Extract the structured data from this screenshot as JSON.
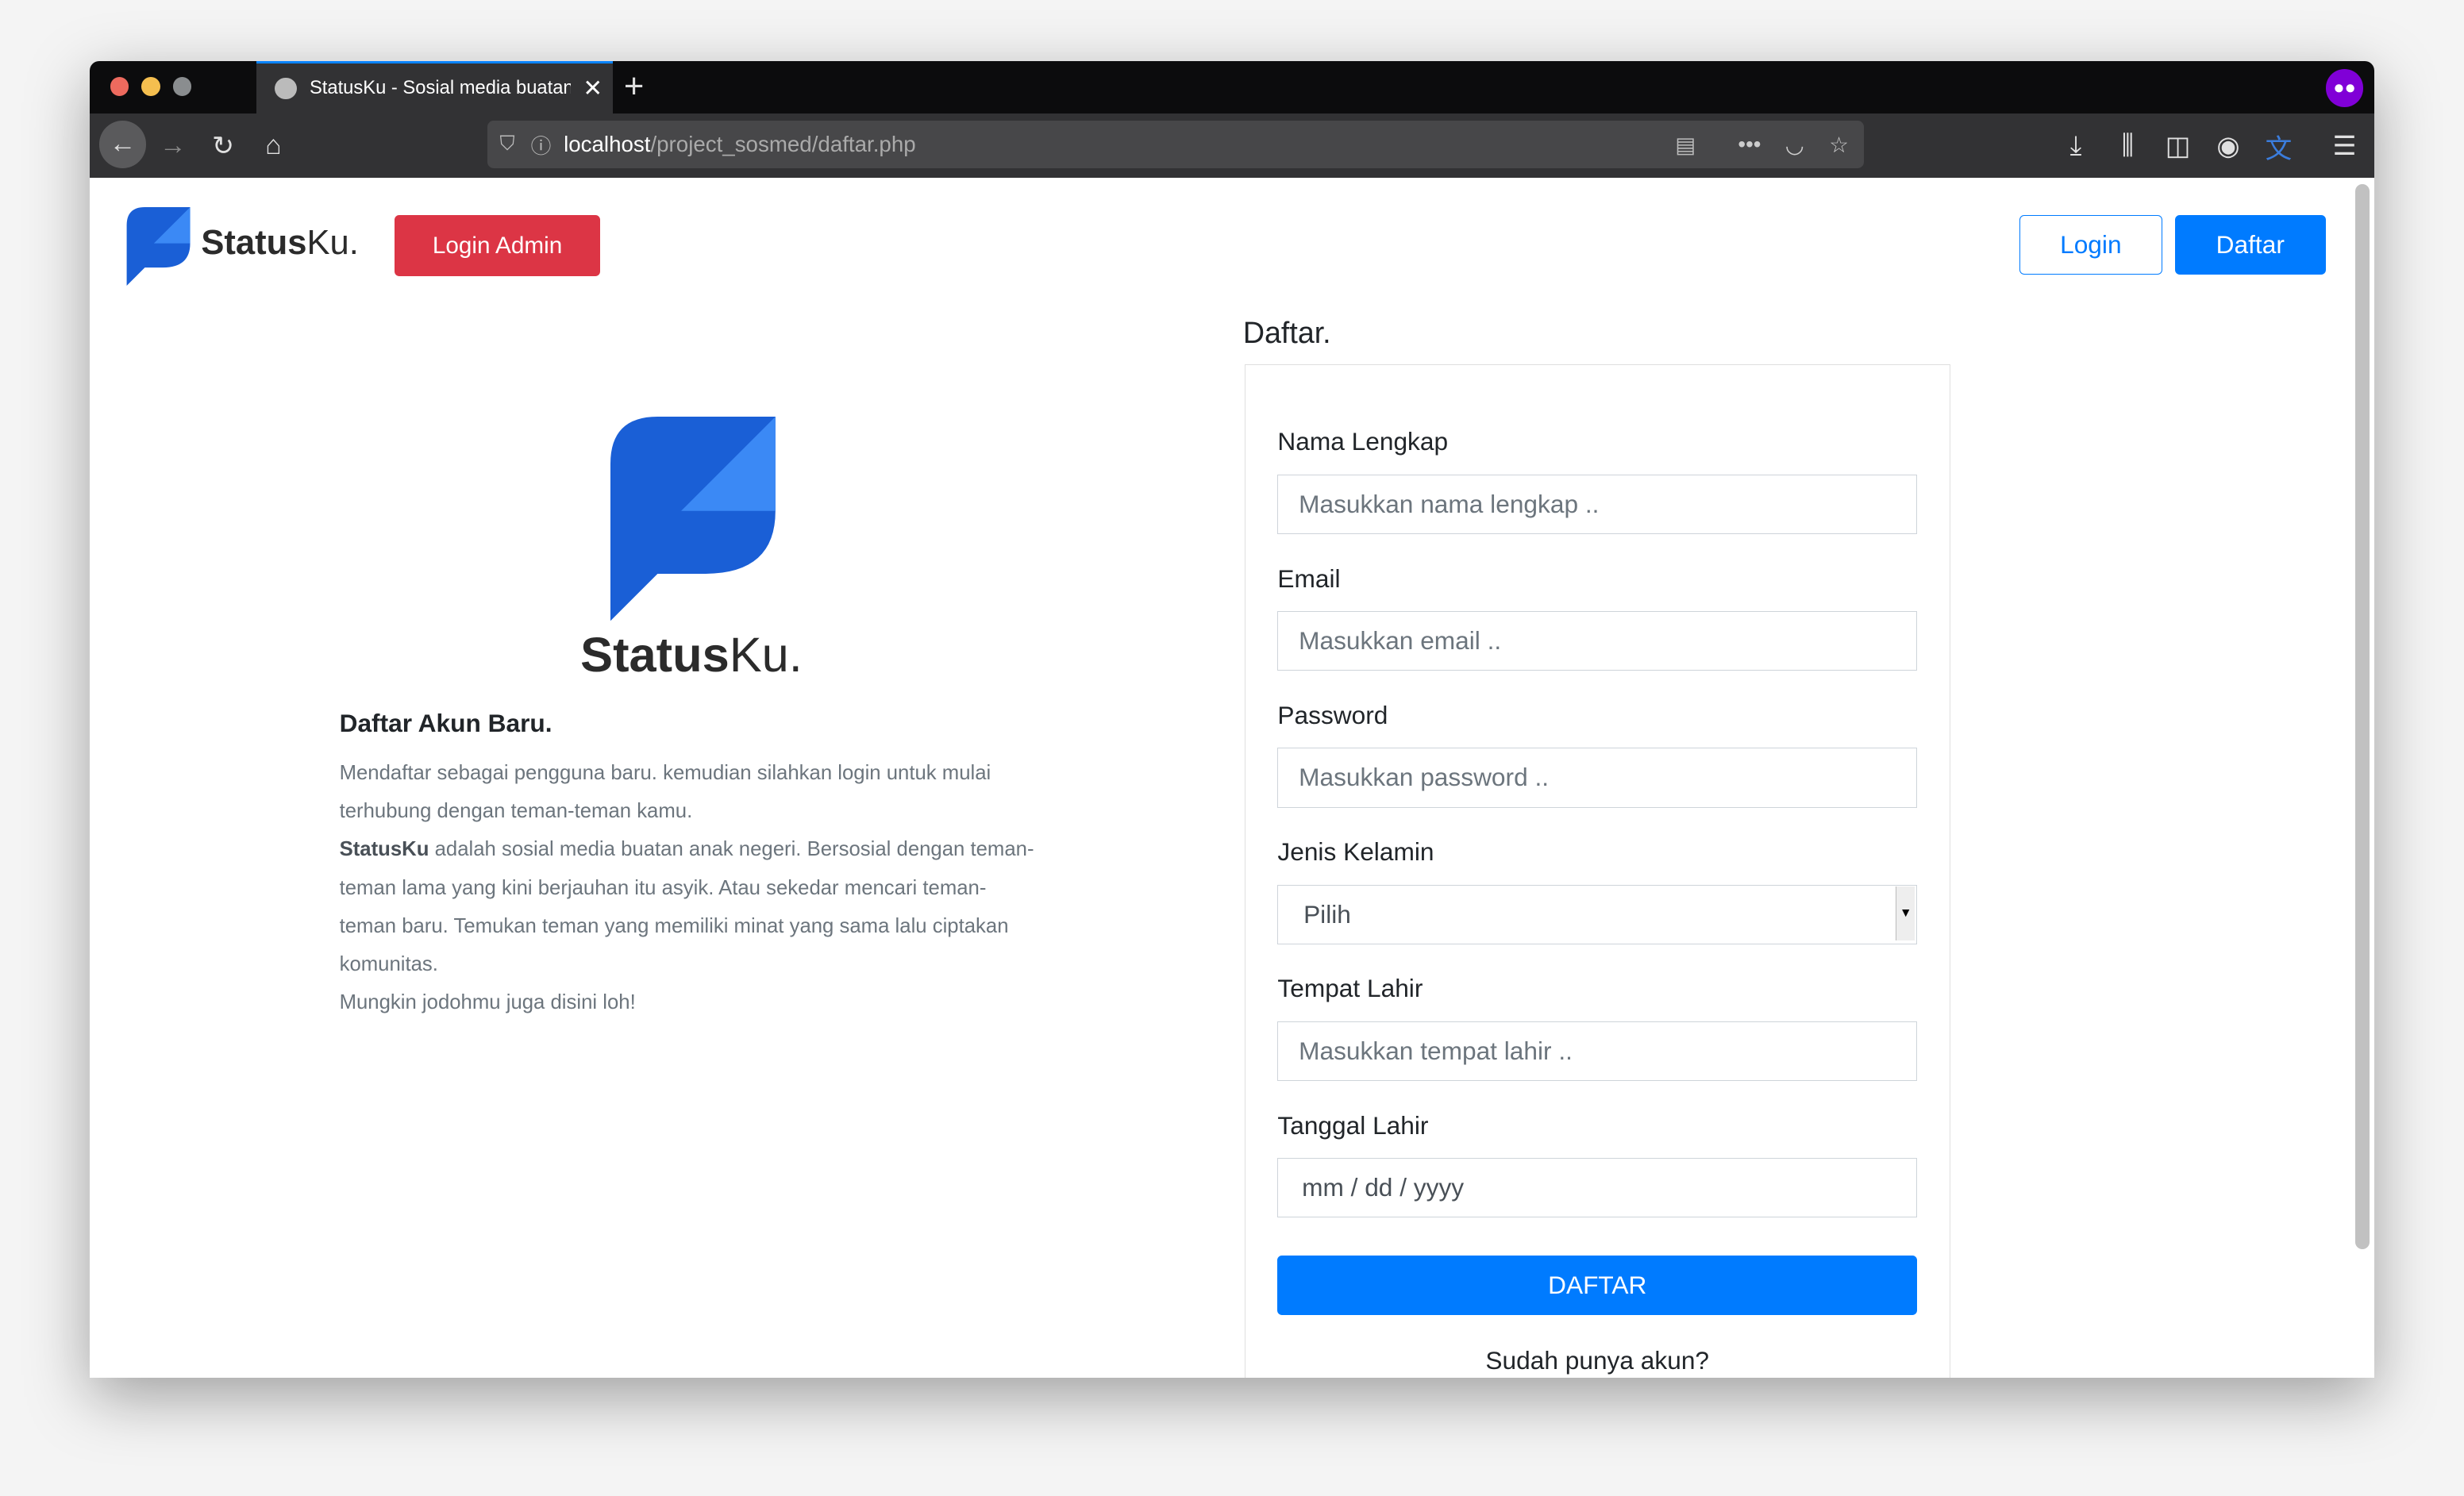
{
  "browser": {
    "tab_title": "StatusKu - Sosial media buatan",
    "url_host": "localhost",
    "url_path": "/project_sosmed/daftar.php",
    "icons": [
      "back-icon",
      "forward-icon",
      "reload-icon",
      "home-icon",
      "shield-icon",
      "info-icon",
      "reader-icon",
      "more-icon",
      "pocket-icon",
      "star-icon",
      "download-icon",
      "library-icon",
      "sidebar-icon",
      "account-icon",
      "translate-icon",
      "menu-icon",
      "private-mask-icon"
    ]
  },
  "navbar": {
    "brand_bold": "Status",
    "brand_light": "Ku.",
    "login_admin": "Login Admin",
    "login": "Login",
    "daftar": "Daftar"
  },
  "intro": {
    "brand_bold": "Status",
    "brand_light": "Ku.",
    "heading": "Daftar Akun Baru.",
    "p1": "Mendaftar sebagai pengguna baru. kemudian silahkan login untuk mulai terhubung dengan teman-teman kamu.",
    "p2_bold": "StatusKu",
    "p2": " adalah sosial media buatan anak negeri. Bersosial dengan teman-teman lama yang kini berjauhan itu asyik. Atau sekedar mencari teman-teman baru. Temukan teman yang memiliki minat yang sama lalu ciptakan komunitas.",
    "p3": "Mungkin jodohmu juga disini loh!"
  },
  "form": {
    "title": "Daftar.",
    "fields": [
      {
        "label": "Nama Lengkap",
        "placeholder": "Masukkan nama lengkap .."
      },
      {
        "label": "Email",
        "placeholder": "Masukkan email .."
      },
      {
        "label": "Password",
        "placeholder": "Masukkan password .."
      },
      {
        "label": "Jenis Kelamin",
        "value": "Pilih"
      },
      {
        "label": "Tempat Lahir",
        "placeholder": "Masukkan tempat lahir .."
      },
      {
        "label": "Tanggal Lahir",
        "placeholder": "mm / dd / yyyy"
      }
    ],
    "submit": "DAFTAR",
    "footer": "Sudah punya akun?"
  },
  "colors": {
    "primary": "#007bff",
    "danger": "#dc3545",
    "logo_dark": "#1a5fd6",
    "logo_light": "#3b89f5"
  }
}
